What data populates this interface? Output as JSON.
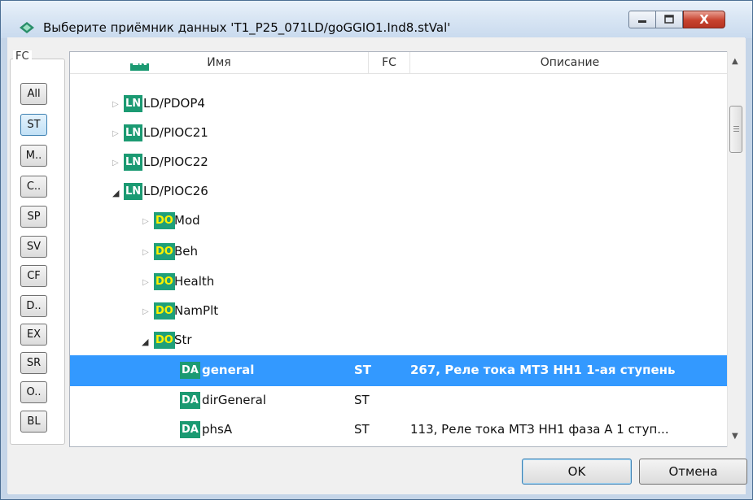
{
  "window": {
    "title": "Выберите приёмник данных 'T1_P25_071LD/goGGIO1.Ind8.stVal'",
    "buttons": {
      "minimize": "minimize-icon",
      "maximize": "maximize-icon",
      "close": "X"
    }
  },
  "fc_panel": {
    "legend": "FC",
    "filters": [
      "All",
      "ST",
      "M..",
      "C..",
      "SP",
      "SV",
      "CF",
      "D..",
      "EX",
      "SR",
      "O..",
      "BL"
    ],
    "active": "ST"
  },
  "tree": {
    "columns": {
      "name": "Имя",
      "fc": "FC",
      "description": "Описание"
    },
    "rows": [
      {
        "badge": "LN",
        "name": "LD/PDOP4",
        "fc": "",
        "desc": ""
      },
      {
        "badge": "LN",
        "name": "LD/PIOC21",
        "fc": "",
        "desc": ""
      },
      {
        "badge": "LN",
        "name": "LD/PIOC22",
        "fc": "",
        "desc": ""
      },
      {
        "badge": "LN",
        "name": "LD/PIOC26",
        "fc": "",
        "desc": ""
      },
      {
        "badge": "DO",
        "name": "Mod",
        "fc": "",
        "desc": ""
      },
      {
        "badge": "DO",
        "name": "Beh",
        "fc": "",
        "desc": ""
      },
      {
        "badge": "DO",
        "name": "Health",
        "fc": "",
        "desc": ""
      },
      {
        "badge": "DO",
        "name": "NamPlt",
        "fc": "",
        "desc": ""
      },
      {
        "badge": "DO",
        "name": "Str",
        "fc": "",
        "desc": ""
      },
      {
        "badge": "DA",
        "name": "general",
        "fc": "ST",
        "desc": "267, Реле тока МТЗ НН1 1-ая ступень"
      },
      {
        "badge": "DA",
        "name": "dirGeneral",
        "fc": "ST",
        "desc": ""
      },
      {
        "badge": "DA",
        "name": "phsA",
        "fc": "ST",
        "desc": "113, Реле тока МТЗ НН1 фаза А 1 ступ..."
      }
    ],
    "selected": "general"
  },
  "footer": {
    "ok_label": "OK",
    "cancel_label": "Отмена"
  },
  "colors": {
    "selection": "#3399ff",
    "badge": "#1b9a72",
    "do_text": "#fff200"
  }
}
